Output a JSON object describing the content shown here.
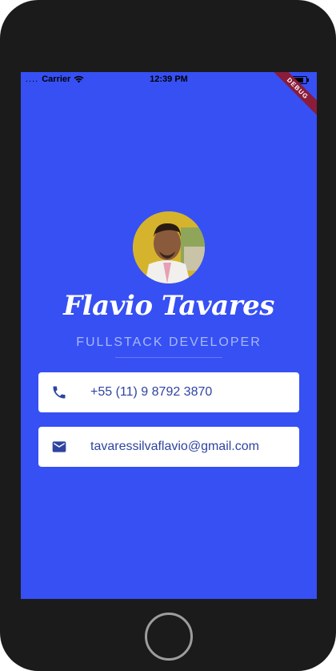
{
  "status_bar": {
    "signal": "....",
    "carrier": "Carrier",
    "time": "12:39 PM"
  },
  "debug_banner": "DEBUG",
  "profile": {
    "name": "Flavio Tavares",
    "title": "FULLSTACK DEVELOPER"
  },
  "contacts": [
    {
      "icon": "phone-icon",
      "value": "+55 (11) 9 8792 3870"
    },
    {
      "icon": "mail-icon",
      "value": "tavaressilvaflavio@gmail.com"
    }
  ],
  "colors": {
    "background": "#3650f4",
    "card": "#ffffff",
    "card_text": "#2f44a0",
    "subtitle": "#a9b7fb"
  }
}
